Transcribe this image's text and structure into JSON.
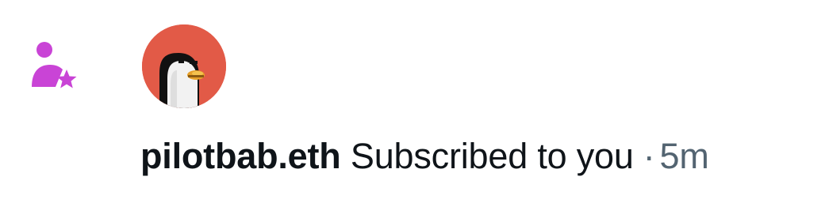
{
  "notification": {
    "icon": "person-star-icon",
    "icon_color": "#c944d6",
    "avatar": {
      "icon": "penguin-avatar",
      "background": "#e25a47"
    },
    "username": "pilotbab.eth",
    "action": "Subscribed to you",
    "separator": "·",
    "time": "5m"
  }
}
